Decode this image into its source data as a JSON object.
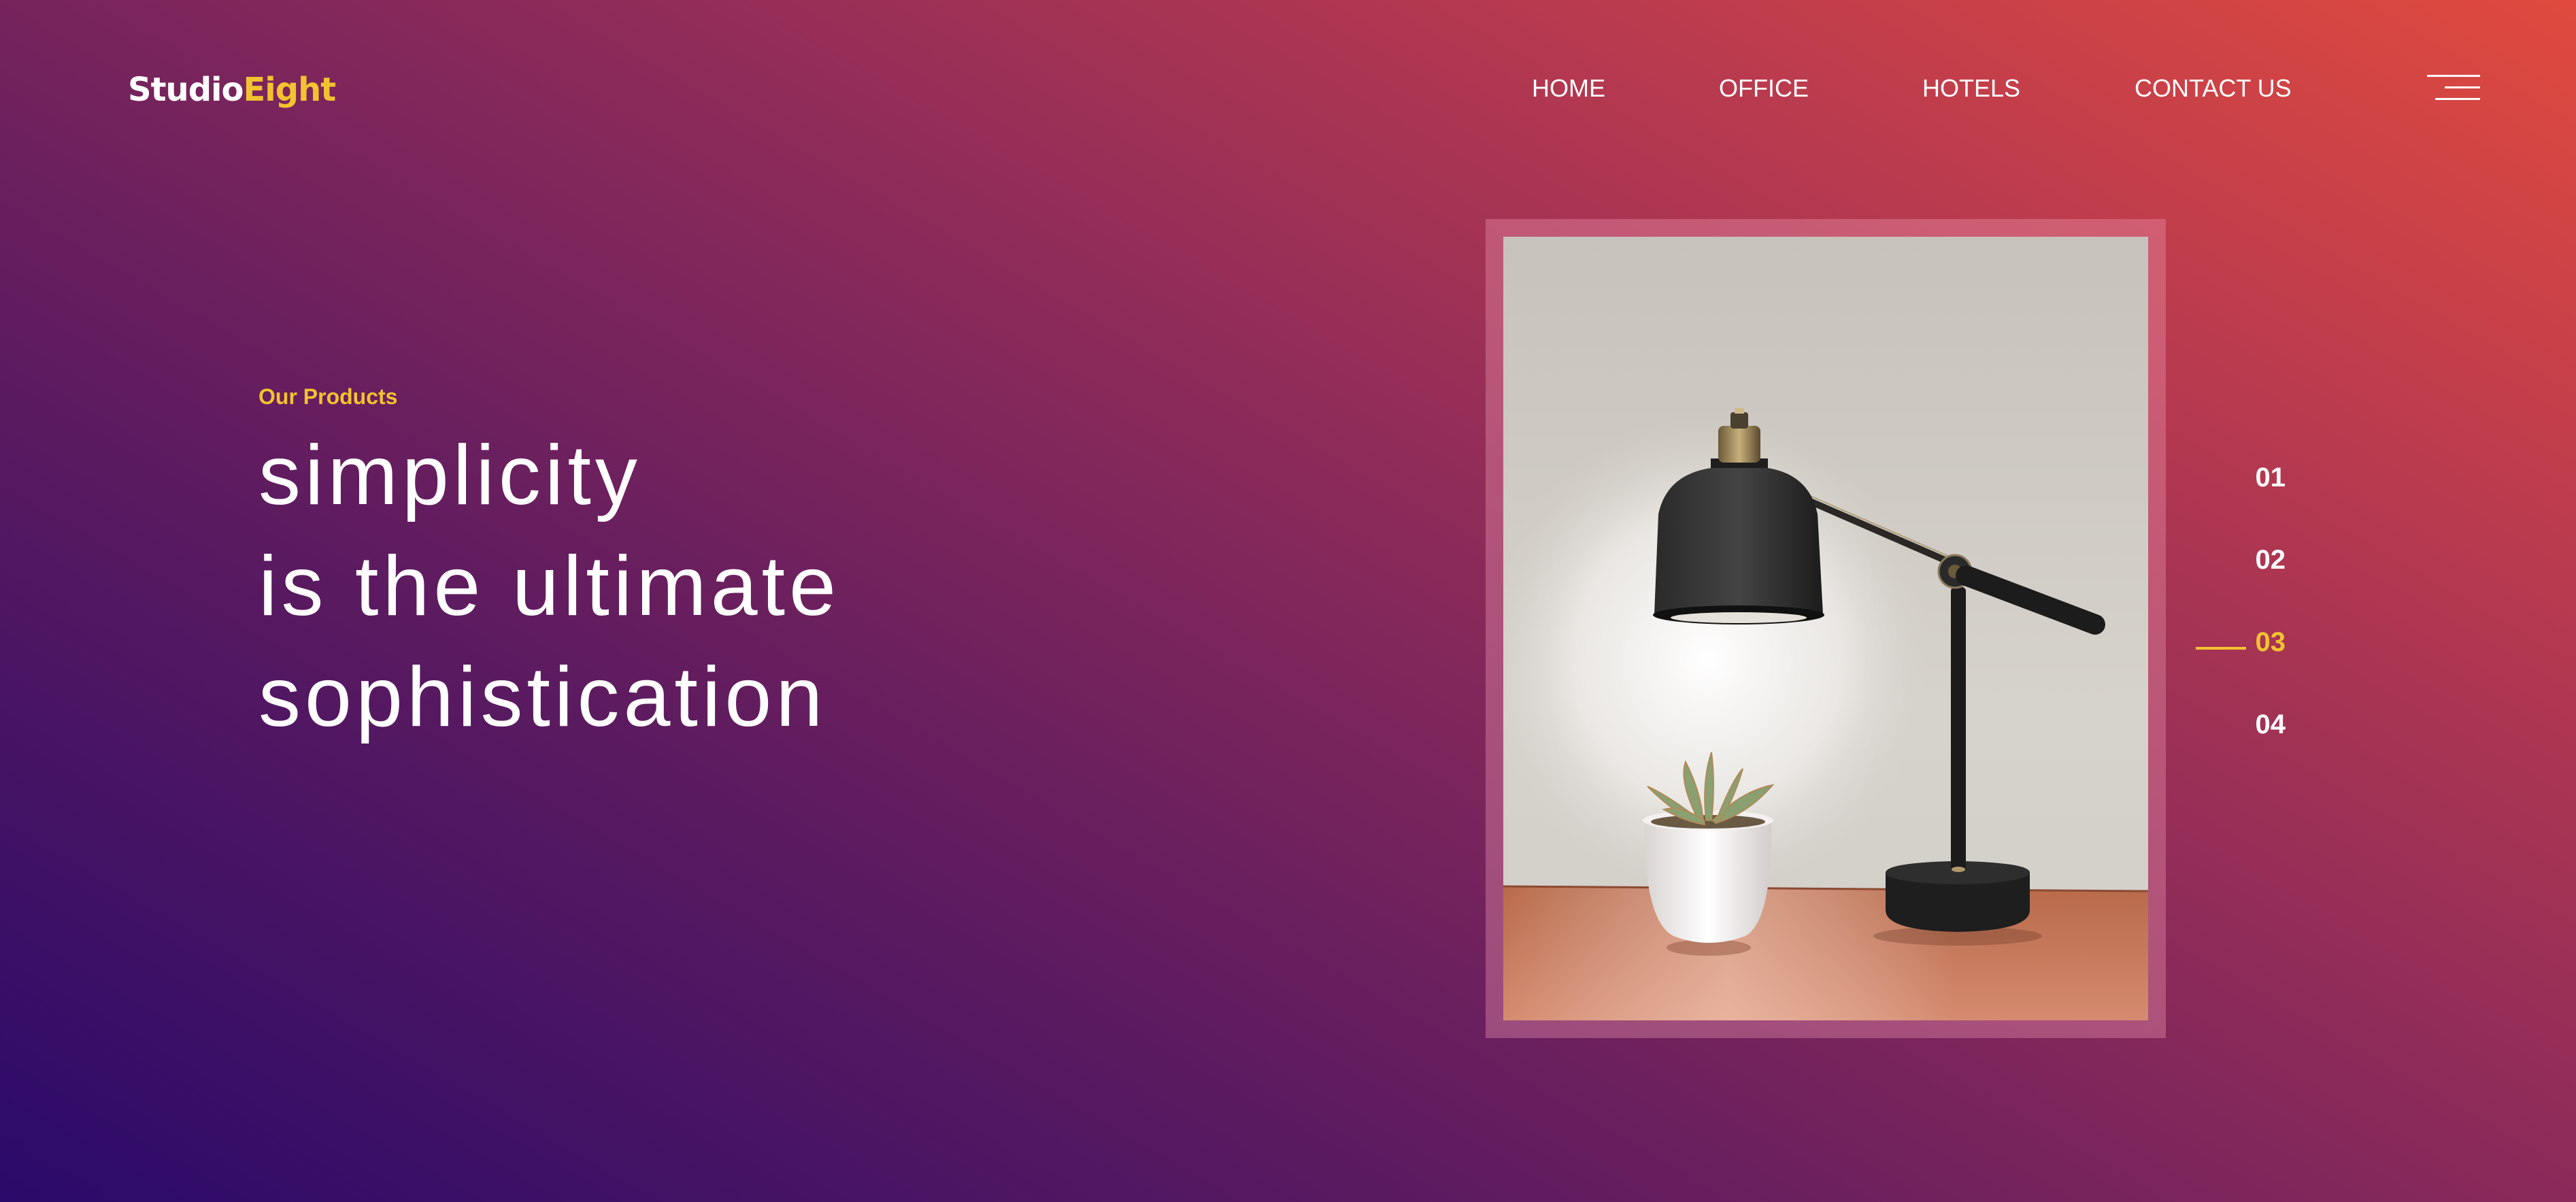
{
  "brand": {
    "name_primary": "Studio",
    "name_accent": "Eight"
  },
  "nav": {
    "items": [
      {
        "label": "HOME"
      },
      {
        "label": "OFFICE"
      },
      {
        "label": "HOTELS"
      },
      {
        "label": "CONTACT US"
      }
    ],
    "menu_icon": "hamburger-menu-icon"
  },
  "hero": {
    "eyebrow": "Our Products",
    "headline": [
      "simplicity",
      "is the ultimate",
      "sophistication"
    ]
  },
  "slides": {
    "items": [
      "01",
      "02",
      "03",
      "04"
    ],
    "active_index": 2
  },
  "colors": {
    "accent": "#f2c230",
    "text": "#ffffff",
    "gradient_start": "#2a0a6a",
    "gradient_end": "#e04a3e"
  }
}
